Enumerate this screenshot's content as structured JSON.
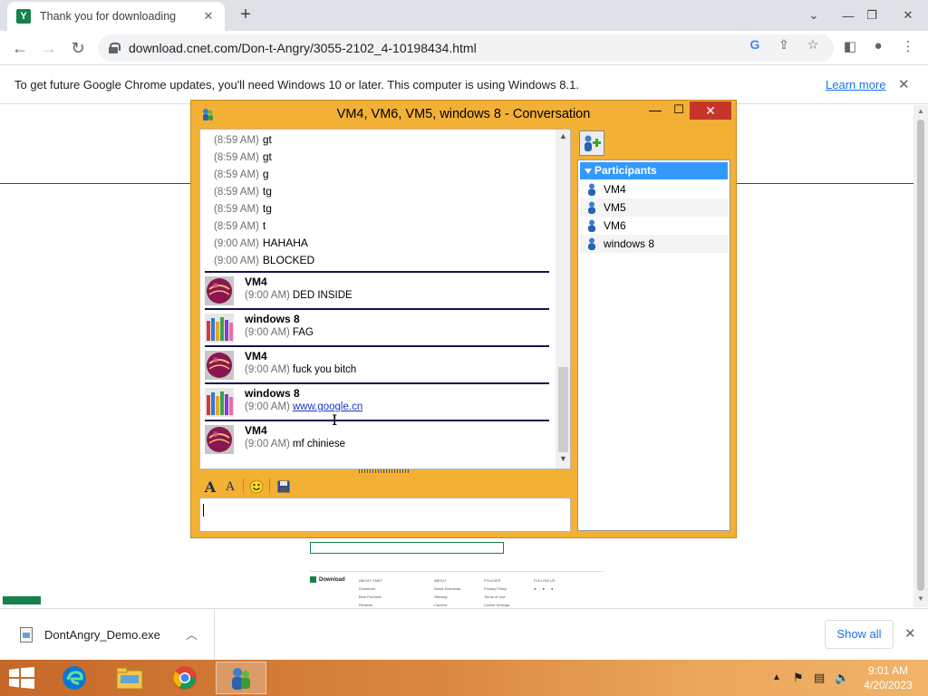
{
  "browser": {
    "tab_title": "Thank you for downloading Don't Angry",
    "tab_favicon_letter": "Y",
    "url": "download.cnet.com/Don-t-Angry/3055-2102_4-10198434.html"
  },
  "infobar": {
    "message": "To get future Google Chrome updates, you'll need Windows 10 or later. This computer is using Windows 8.1.",
    "learn_more": "Learn more"
  },
  "page": {
    "footer_logo": "Download",
    "footer_columns": [
      [
        "ABOUT CNET",
        "Download",
        "Best Products",
        "Reviews"
      ],
      [
        "ABOUT",
        "About Download",
        "Sitemap",
        "Careers"
      ],
      [
        "POLICIES",
        "Privacy Policy",
        "Terms of Use",
        "Cookie Settings"
      ],
      [
        "FOLLOW US"
      ]
    ]
  },
  "im_window": {
    "title": "VM4, VM6, VM5, windows 8 - Conversation",
    "simple_lines": [
      {
        "time": "(8:59 AM)",
        "text": "gt"
      },
      {
        "time": "(8:59 AM)",
        "text": "gt"
      },
      {
        "time": "(8:59 AM)",
        "text": "g"
      },
      {
        "time": "(8:59 AM)",
        "text": "tg"
      },
      {
        "time": "(8:59 AM)",
        "text": "tg"
      },
      {
        "time": "(8:59 AM)",
        "text": "t"
      },
      {
        "time": "(9:00 AM)",
        "text": "HAHAHA"
      },
      {
        "time": "(9:00 AM)",
        "text": "BLOCKED"
      }
    ],
    "messages": [
      {
        "sender": "VM4",
        "time": "(9:00 AM)",
        "text": "DED INSIDE",
        "avatar": "ball"
      },
      {
        "sender": "windows 8",
        "time": "(9:00 AM)",
        "text": "FAG",
        "avatar": "crayons"
      },
      {
        "sender": "VM4",
        "time": "(9:00 AM)",
        "text": "fuck you bitch",
        "avatar": "ball"
      },
      {
        "sender": "windows 8",
        "time": "(9:00 AM)",
        "text": "www.google.cn",
        "avatar": "crayons",
        "is_link": true
      },
      {
        "sender": "VM4",
        "time": "(9:00 AM)",
        "text": "mf chiniese",
        "avatar": "ball"
      }
    ],
    "input_value": "",
    "participants_header": "Participants",
    "participants": [
      "VM4",
      "VM5",
      "VM6",
      "windows 8"
    ]
  },
  "download_shelf": {
    "file_name": "DontAngry_Demo.exe",
    "show_all": "Show all"
  },
  "taskbar": {
    "time": "9:01 AM",
    "date": "4/20/2023",
    "apps": [
      "file-explorer",
      "chrome",
      "messenger"
    ]
  },
  "colors": {
    "im_frame": "#f2b035",
    "im_close": "#c7352a",
    "participants_header": "#3399ff",
    "divider": "#14144e",
    "link": "#1a37c8",
    "cnet_green": "#18804a"
  }
}
